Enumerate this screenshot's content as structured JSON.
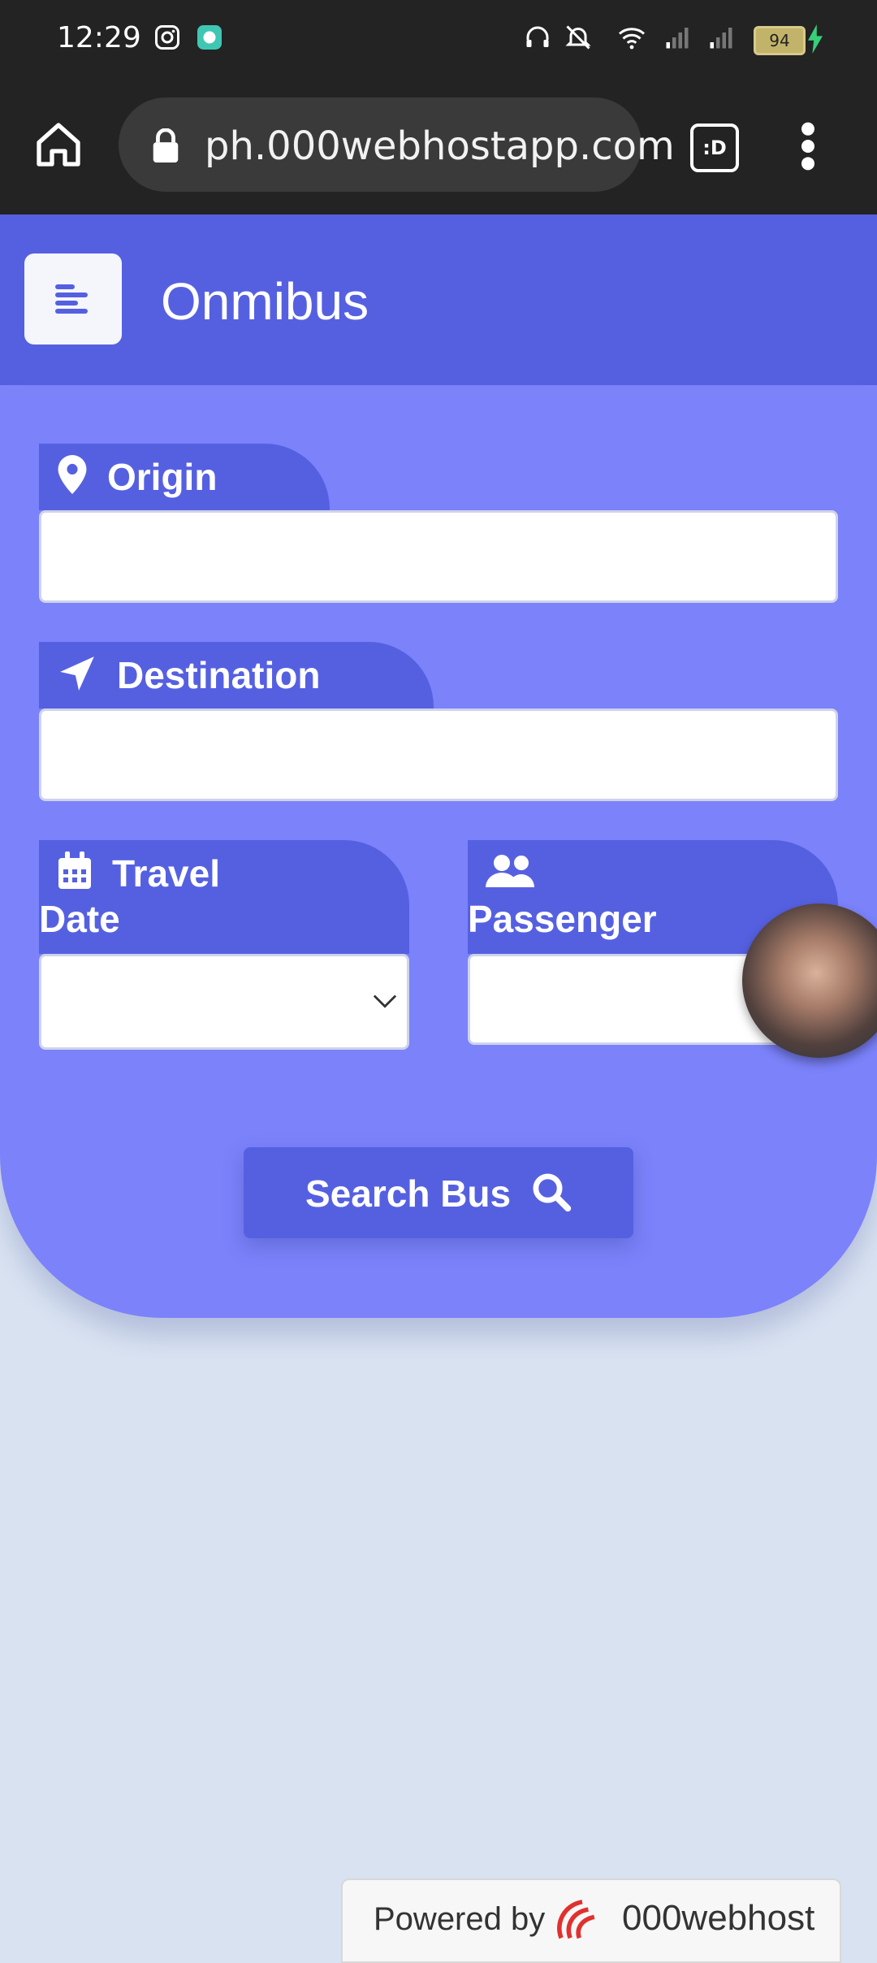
{
  "status_bar": {
    "time": "12:29",
    "battery_percent": "94"
  },
  "browser": {
    "url": "ph.000webhostapp.com",
    "tab_switcher_label": ":D"
  },
  "app": {
    "title": "Onmibus"
  },
  "form": {
    "origin_label": "Origin",
    "destination_label": "Destination",
    "travel_label_line1": "Travel",
    "travel_label_line2": "Date",
    "passenger_label": "Passenger",
    "search_button_label": "Search Bus"
  },
  "footer": {
    "powered_by": "Powered by",
    "brand": "000webhost"
  },
  "colors": {
    "header_bg": "#5560e1",
    "card_bg": "#7b82fa",
    "page_bg": "#d8e2f1"
  }
}
